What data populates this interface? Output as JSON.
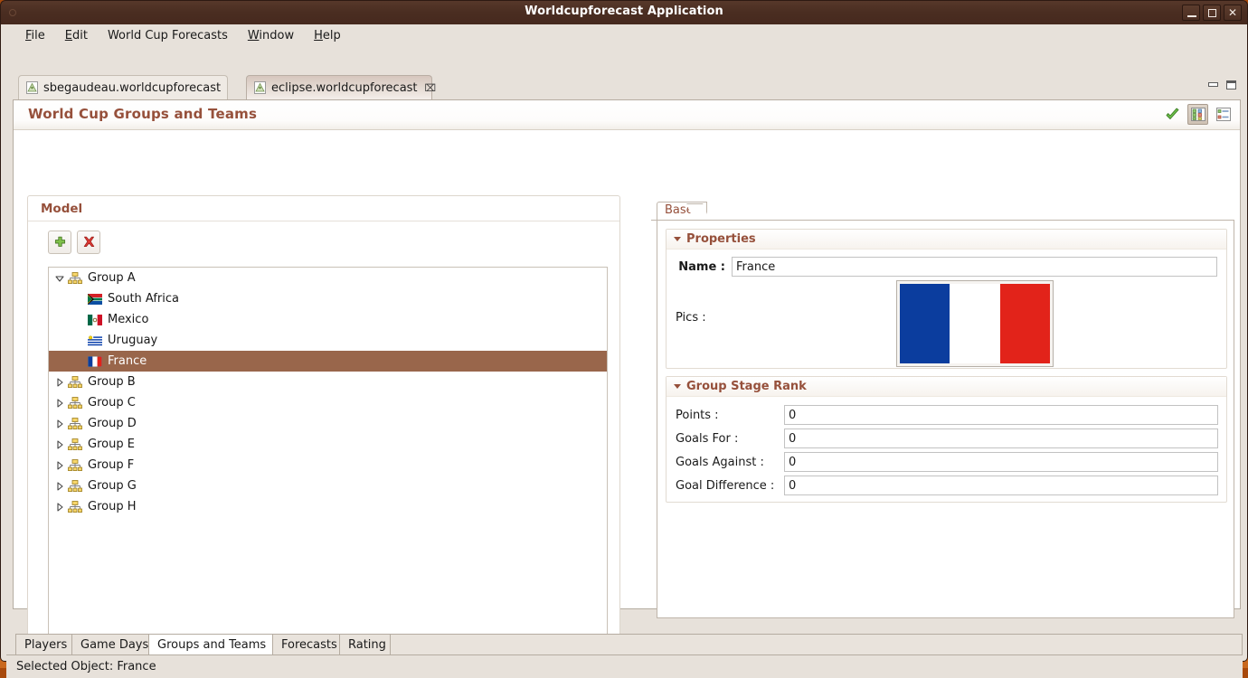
{
  "window": {
    "title": "Worldcupforecast Application",
    "buttons": {
      "minimize": "minimize-icon",
      "maximize": "maximize-icon",
      "close": "close-icon"
    }
  },
  "menubar": {
    "items": [
      {
        "label": "File",
        "mnemonic": "F"
      },
      {
        "label": "Edit",
        "mnemonic": "E"
      },
      {
        "label": "World Cup Forecasts",
        "mnemonic": "W"
      },
      {
        "label": "Window",
        "mnemonic": "W"
      },
      {
        "label": "Help",
        "mnemonic": "H"
      }
    ]
  },
  "editor_tabs": {
    "items": [
      {
        "label": "sbegaudeau.worldcupforecast",
        "active": false,
        "closable": false
      },
      {
        "label": "eclipse.worldcupforecast",
        "active": true,
        "closable": true,
        "close_glyph": "⌧"
      }
    ],
    "view_minimize": "minimize-view-icon",
    "view_maximize": "maximize-view-icon"
  },
  "form": {
    "title": "World Cup Groups and Teams",
    "toolbar": [
      {
        "name": "validate-icon",
        "glyph": "✔",
        "pressed": false
      },
      {
        "name": "tree-view-icon",
        "glyph": "",
        "pressed": true
      },
      {
        "name": "list-view-icon",
        "glyph": "",
        "pressed": false
      }
    ]
  },
  "model": {
    "group_title": "Model",
    "buttons": [
      {
        "name": "add-button",
        "glyph": "+"
      },
      {
        "name": "delete-button",
        "glyph": "✖"
      }
    ],
    "tree": [
      {
        "label": "Group A",
        "type": "group",
        "expanded": true,
        "level": 0,
        "selected": false
      },
      {
        "label": "South Africa",
        "type": "team",
        "flag": "south-africa",
        "level": 1,
        "selected": false
      },
      {
        "label": "Mexico",
        "type": "team",
        "flag": "mexico",
        "level": 1,
        "selected": false
      },
      {
        "label": "Uruguay",
        "type": "team",
        "flag": "uruguay",
        "level": 1,
        "selected": false
      },
      {
        "label": "France",
        "type": "team",
        "flag": "france",
        "level": 1,
        "selected": true
      },
      {
        "label": "Group B",
        "type": "group",
        "expanded": false,
        "level": 0,
        "selected": false
      },
      {
        "label": "Group C",
        "type": "group",
        "expanded": false,
        "level": 0,
        "selected": false
      },
      {
        "label": "Group D",
        "type": "group",
        "expanded": false,
        "level": 0,
        "selected": false
      },
      {
        "label": "Group E",
        "type": "group",
        "expanded": false,
        "level": 0,
        "selected": false
      },
      {
        "label": "Group F",
        "type": "group",
        "expanded": false,
        "level": 0,
        "selected": false
      },
      {
        "label": "Group G",
        "type": "group",
        "expanded": false,
        "level": 0,
        "selected": false
      },
      {
        "label": "Group H",
        "type": "group",
        "expanded": false,
        "level": 0,
        "selected": false
      }
    ]
  },
  "properties_panel": {
    "tab_label": "Base",
    "sections": [
      {
        "title": "Properties",
        "fields": [
          {
            "label": "Name :",
            "value": "France",
            "bold_label": true
          }
        ],
        "pics_label": "Pics :",
        "pic_alt": "france-flag"
      },
      {
        "title": "Group Stage Rank",
        "fields": [
          {
            "label": "Points :",
            "value": "0"
          },
          {
            "label": "Goals For :",
            "value": "0"
          },
          {
            "label": "Goals Against :",
            "value": "0"
          },
          {
            "label": "Goal Difference :",
            "value": "0"
          }
        ]
      }
    ]
  },
  "bottom_tabs": {
    "items": [
      {
        "label": "Players",
        "active": false
      },
      {
        "label": "Game Days",
        "active": false
      },
      {
        "label": "Groups and Teams",
        "active": true
      },
      {
        "label": "Forecasts",
        "active": false
      },
      {
        "label": "Rating",
        "active": false
      }
    ]
  },
  "statusbar": {
    "text": "Selected Object: France"
  },
  "colors": {
    "titlebar": "#4a2d21",
    "desktop": "#bf5f18",
    "accent_heading": "#96503b",
    "selection": "#99664b",
    "chrome": "#e7e1da",
    "flag_blue": "#0b3d9e",
    "flag_white": "#ffffff",
    "flag_red": "#e2231a"
  }
}
